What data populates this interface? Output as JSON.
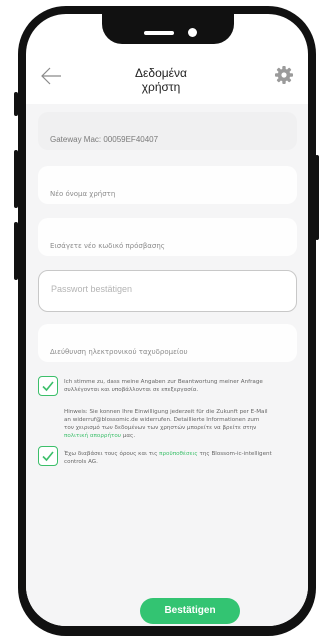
{
  "header": {
    "title": "Δεδομένα\nχρήστη",
    "back_icon": "arrow-left-icon",
    "settings_icon": "gear-icon"
  },
  "form": {
    "gateway_mac": "Gateway Mac: 00059EF40407",
    "new_username": "Νέο όνομα χρήστη",
    "new_password": "Εισάγετε νέο κωδικό πρόσβασης",
    "confirm_password": "Passwort bestätigen",
    "email": "Διεύθυνση ηλεκτρονικού ταχυδρομείου"
  },
  "consent1": {
    "line1": "Ich stimme zu, dass meine Angaben zur Beantwortung meiner Anfrage",
    "line2": "συλλέγονται και υποβάλλονται σε επεξεργασία."
  },
  "hinweis": {
    "line1": "Hinweis: Sie konnen Ihre Einwilligung jederzeit für die Zukunft per E-Mail",
    "line2": "an widerruf@blossomic.de widerrufen. Detaillierte Informationen zum",
    "line3": "τον χειρισμό των δεδομένων των χρηστών μπορείτε να βρείτε στην",
    "policy_link": "πολιτική απορρήτου",
    "line3_suffix": " μας."
  },
  "consent2": {
    "pre": "Έχω διαβάσει τους όρους και τις ",
    "link": "προϋποθέσεις",
    "post": " της Blossom-ic-intelligent",
    "line2": "controls AG."
  },
  "submit_label": "Bestätigen",
  "colors": {
    "accent": "#33c472",
    "check_border": "#3cbf6a",
    "content_bg": "#f5f5f6"
  }
}
